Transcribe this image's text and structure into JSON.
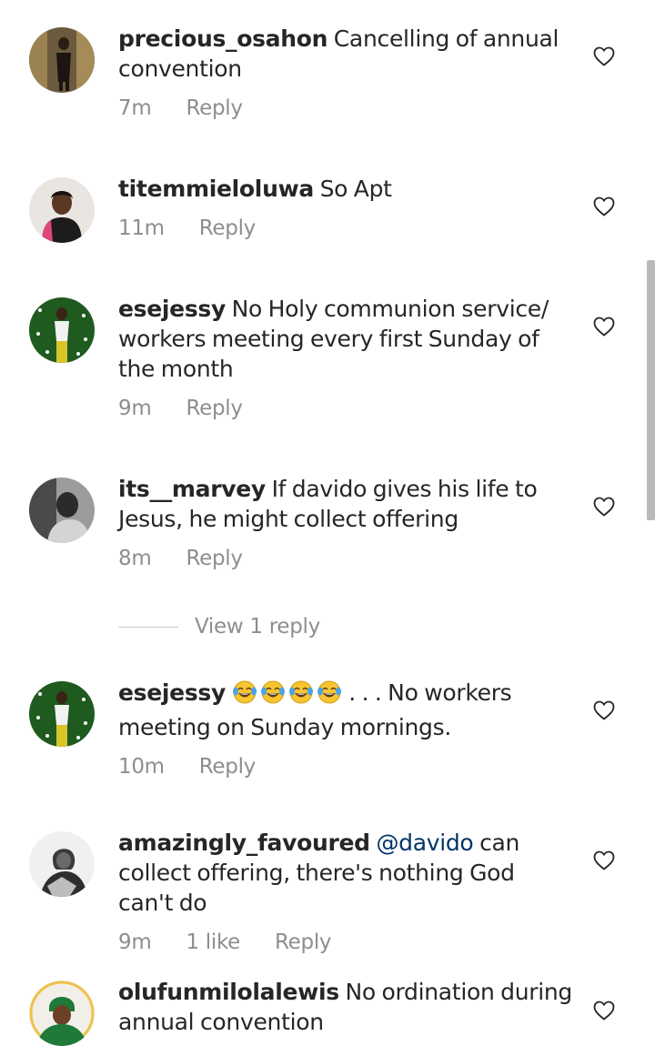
{
  "comments": [
    {
      "username": "precious_osahon",
      "text": "Cancelling of annual convention",
      "time": "7m",
      "reply_label": "Reply"
    },
    {
      "username": "titemmieloluwa",
      "text": "So Apt",
      "time": "11m",
      "reply_label": "Reply"
    },
    {
      "username": "esejessy",
      "text": "No Holy communion service/ workers meeting every first Sunday of the month",
      "time": "9m",
      "reply_label": "Reply"
    },
    {
      "username": "its__marvey",
      "text": "If davido gives his life to Jesus, he might collect offering",
      "time": "8m",
      "reply_label": "Reply"
    },
    {
      "username": "esejessy",
      "text": ". . . No workers meeting on Sunday mornings.",
      "emoji": "face-with-tears-of-joy x4",
      "time": "10m",
      "reply_label": "Reply"
    },
    {
      "username": "amazingly_favoured",
      "mention": "@davido",
      "text": "can collect offering, there's nothing God can't do",
      "time": "9m",
      "likes": "1 like",
      "reply_label": "Reply"
    },
    {
      "username": "olufunmilolalewis",
      "text": "No ordination during annual convention"
    }
  ],
  "view_replies_label": "View 1 reply",
  "icons": {
    "like": "heart-outline-icon",
    "emoji": "face-with-tears-of-joy"
  },
  "colors": {
    "text": "#262626",
    "meta": "#8e8e8e",
    "mention": "#003569"
  }
}
